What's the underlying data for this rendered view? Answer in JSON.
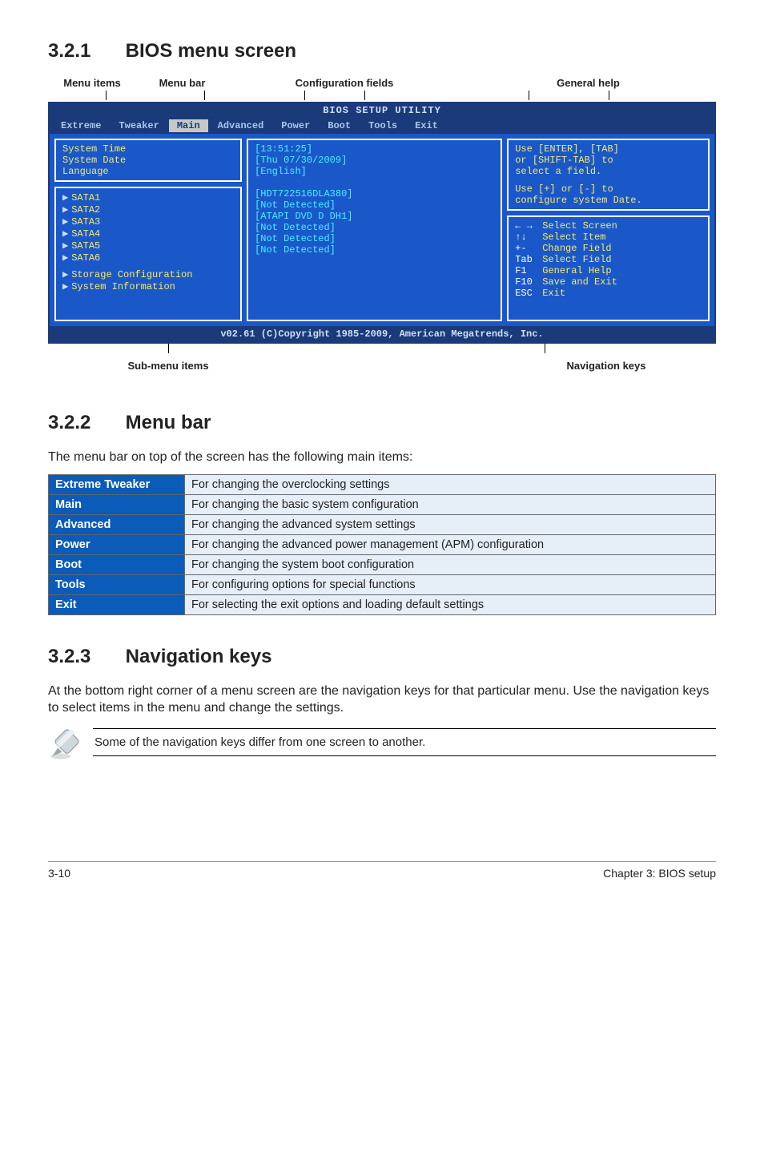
{
  "sections": {
    "s1": {
      "num": "3.2.1",
      "title": "BIOS menu screen"
    },
    "s2": {
      "num": "3.2.2",
      "title": "Menu bar"
    },
    "s3": {
      "num": "3.2.3",
      "title": "Navigation keys"
    }
  },
  "labels_top": {
    "menu_items": "Menu items",
    "menu_bar": "Menu bar",
    "config_fields": "Configuration fields",
    "general_help": "General help"
  },
  "bios": {
    "header": "BIOS SETUP UTILITY",
    "tabs": [
      "Extreme",
      "Tweaker",
      "Main",
      "Advanced",
      "Power",
      "Boot",
      "Tools",
      "Exit"
    ],
    "selected_tab": "Main",
    "left_top": [
      "System Time",
      "System Date",
      "Language"
    ],
    "left_bot_items": [
      "SATA1",
      "SATA2",
      "SATA3",
      "SATA4",
      "SATA5",
      "SATA6"
    ],
    "left_bot_extra": [
      "Storage Configuration",
      "System Information"
    ],
    "mid_top": [
      "[13:51:25]",
      "[Thu 07/30/2009]",
      "[English]"
    ],
    "mid_bot": [
      "[HDT722516DLA380]",
      "[Not Detected]",
      "[ATAPI DVD D DH1]",
      "[Not Detected]",
      "[Not Detected]",
      "[Not Detected]"
    ],
    "right_top": [
      "Use [ENTER], [TAB]",
      "or [SHIFT-TAB] to",
      "select a field.",
      "",
      "Use [+] or [-] to",
      "configure system Date."
    ],
    "right_bot": [
      [
        "←  →",
        "Select Screen"
      ],
      [
        "↑↓",
        "Select Item"
      ],
      [
        "+-",
        "Change Field"
      ],
      [
        "Tab",
        "Select Field"
      ],
      [
        "F1",
        "General Help"
      ],
      [
        "F10",
        "Save and Exit"
      ],
      [
        "ESC",
        "Exit"
      ]
    ],
    "footer": "v02.61 (C)Copyright 1985-2009, American Megatrends, Inc."
  },
  "labels_bot": {
    "sub_menu": "Sub-menu items",
    "nav_keys": "Navigation keys"
  },
  "menu_bar_intro": "The menu bar on top of the screen has the following main items:",
  "defs": [
    [
      "Extreme Tweaker",
      "For changing the overclocking settings"
    ],
    [
      "Main",
      "For changing the basic system configuration"
    ],
    [
      "Advanced",
      "For changing the advanced system settings"
    ],
    [
      "Power",
      "For changing the advanced power management (APM) configuration"
    ],
    [
      "Boot",
      "For changing the system boot configuration"
    ],
    [
      "Tools",
      "For configuring options for special functions"
    ],
    [
      "Exit",
      "For selecting the exit options and loading default settings"
    ]
  ],
  "nav_intro": "At the bottom right corner of a menu screen are the navigation keys for that particular menu. Use the navigation keys to select items in the menu and change the settings.",
  "note": "Some of the navigation keys differ from one screen to another.",
  "footer": {
    "left": "3-10",
    "right": "Chapter 3: BIOS setup"
  }
}
